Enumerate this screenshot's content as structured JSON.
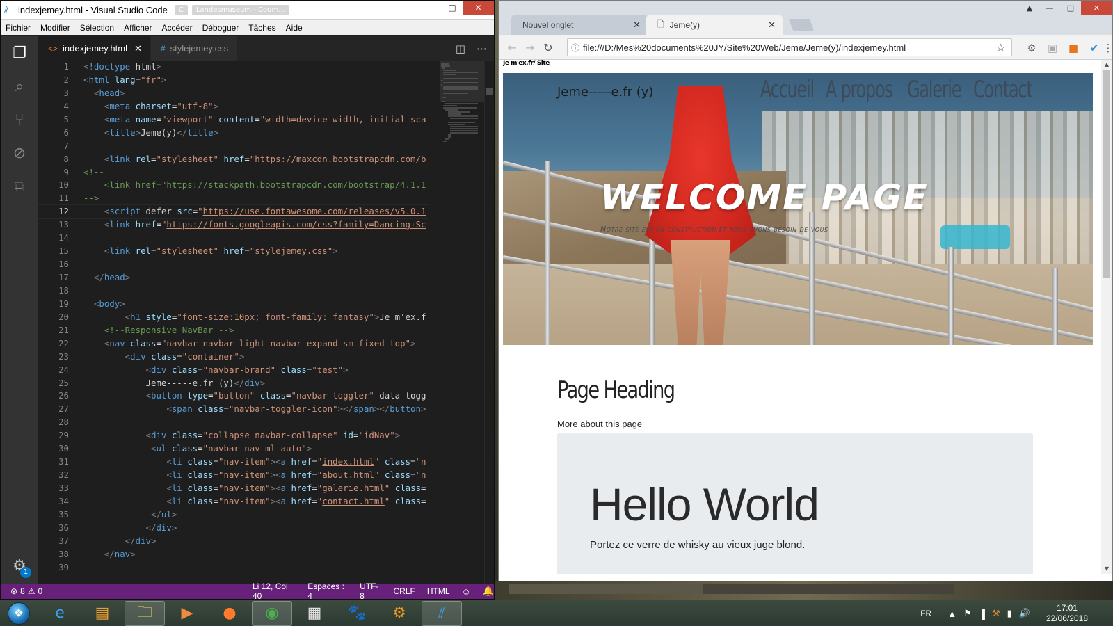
{
  "vscode": {
    "title": "indexjemey.html - Visual Studio Code",
    "ghost_tabs": [
      "C",
      "Landesmuseum - Coum..."
    ],
    "menu": [
      "Fichier",
      "Modifier",
      "Sélection",
      "Afficher",
      "Accéder",
      "Déboguer",
      "Tâches",
      "Aide"
    ],
    "tabs": [
      {
        "label": "indexjemey.html",
        "icon": "html-file-icon"
      },
      {
        "label": "stylejemey.css",
        "icon": "css-file-icon"
      }
    ],
    "current_line": 12,
    "status": {
      "errors": "8",
      "warnings": "0",
      "position": "Li 12, Col 40",
      "spaces": "Espaces : 4",
      "encoding": "UTF-8",
      "eol": "CRLF",
      "language": "HTML"
    },
    "settings_badge": "1",
    "code_lines": [
      "<!doctype html>",
      "<html lang=\"fr\">",
      "  <head>",
      "    <meta charset=\"utf-8\">",
      "    <meta name=\"viewport\" content=\"width=device-width, initial-sca",
      "    <title>Jeme(y)</title>",
      "",
      "    <link rel=\"stylesheet\" href=\"https://maxcdn.bootstrapcdn.com/b",
      "<!--",
      "    <link href=\"https://stackpath.bootstrapcdn.com/bootstrap/4.1.1",
      "-->",
      "    <script defer src=\"https://use.fontawesome.com/releases/v5.0.1",
      "    <link href=\"https://fonts.googleapis.com/css?family=Dancing+Sc",
      "",
      "    <link rel=\"stylesheet\" href=\"stylejemey.css\">",
      "",
      "  </head>",
      "",
      "  <body>",
      "        <h1 style=\"font-size:10px; font-family: fantasy\">Je m'ex.f",
      "    <!--Responsive NavBar -->",
      "    <nav class=\"navbar navbar-light navbar-expand-sm fixed-top\">",
      "        <div class=\"container\">",
      "            <div class=\"navbar-brand\" class=\"test\">",
      "            Jeme-----e.fr (y)</div>",
      "            <button type=\"button\" class=\"navbar-toggler\" data-togg",
      "                <span class=\"navbar-toggler-icon\"></span></button>",
      "",
      "            <div class=\"collapse navbar-collapse\" id=\"idNav\">",
      "             <ul class=\"navbar-nav ml-auto\">",
      "                <li class=\"nav-item\"><a href=\"index.html\" class=\"n",
      "                <li class=\"nav-item\"><a href=\"about.html\" class=\"n",
      "                <li class=\"nav-item\"><a href=\"galerie.html\" class=",
      "                <li class=\"nav-item\"><a href=\"contact.html\" class=",
      "             </ul>",
      "            </div>",
      "        </div>",
      "    </nav>",
      ""
    ]
  },
  "chrome": {
    "tabs": [
      {
        "label": "Nouvel onglet"
      },
      {
        "label": "Jeme(y)"
      }
    ],
    "url": "file:///D:/Mes%20documents%20JY/Site%20Web/Jeme/Jeme(y)/indexjemey.html",
    "page": {
      "tiny_heading": "Je m'ex.fr/ Site",
      "brand": "Jeme-----e.fr (y)",
      "nav": [
        "Accueil",
        "A propos",
        "Galerie",
        "Contact"
      ],
      "welcome": "WELCOME PAGE",
      "welcome_sub": "Notre site est en construction et nous avons besoin de vous",
      "heading": "Page Heading",
      "heading_sub": "More about this page",
      "jumbo_title": "Hello World",
      "jumbo_text": "Portez ce verre de whisky au vieux juge blond."
    }
  },
  "taskbar": {
    "apps": [
      "internet-explorer-icon",
      "installer-icon",
      "file-explorer-icon",
      "media-player-icon",
      "firefox-icon",
      "chrome-icon",
      "calculator-icon",
      "gimp-icon",
      "settings-app-icon",
      "vscode-icon"
    ],
    "lang": "FR",
    "time": "17:01",
    "date": "22/06/2018"
  },
  "colors": {
    "vscode_status": "#68217a",
    "vscode_bg": "#1e1e1e",
    "close_red": "#c8483a"
  }
}
